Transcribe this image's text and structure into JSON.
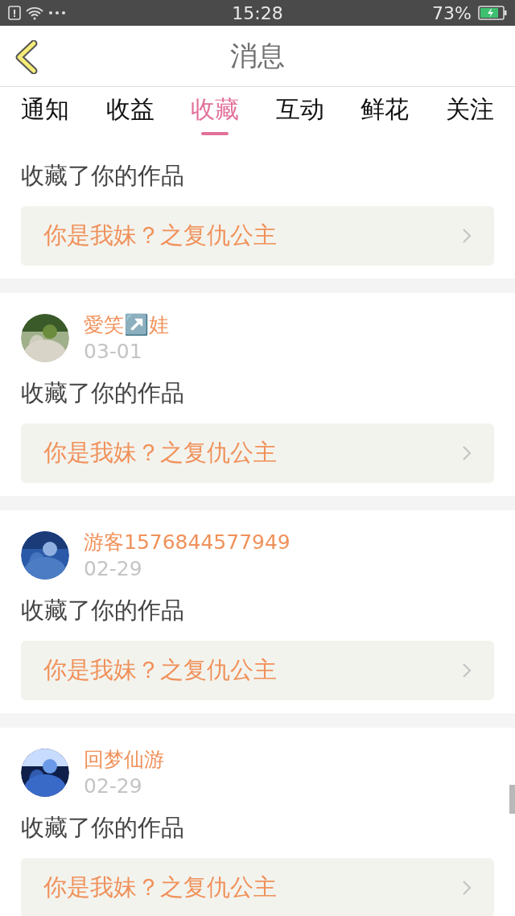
{
  "status_bar": {
    "time": "15:28",
    "battery": "73%"
  },
  "header": {
    "title": "消息"
  },
  "tabs": [
    {
      "label": "通知",
      "selected": false
    },
    {
      "label": "收益",
      "selected": false
    },
    {
      "label": "收藏",
      "selected": true
    },
    {
      "label": "互动",
      "selected": false
    },
    {
      "label": "鲜花",
      "selected": false
    },
    {
      "label": "关注",
      "selected": false
    }
  ],
  "messages": [
    {
      "action": "收藏了你的作品",
      "work": "你是我妹？之复仇公主"
    },
    {
      "user": "愛笑↗️娃",
      "date": "03-01",
      "action": "收藏了你的作品",
      "work": "你是我妹？之复仇公主"
    },
    {
      "user": "游客1576844577949",
      "date": "02-29",
      "action": "收藏了你的作品",
      "work": "你是我妹？之复仇公主"
    },
    {
      "user": "回梦仙游",
      "date": "02-29",
      "action": "收藏了你的作品",
      "work": "你是我妹？之复仇公主"
    }
  ]
}
